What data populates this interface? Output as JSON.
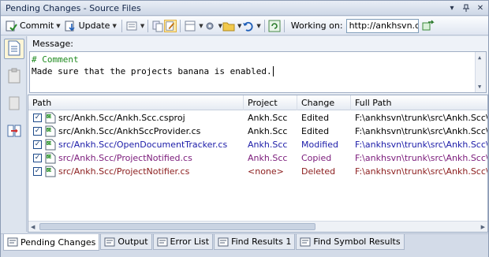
{
  "window": {
    "title": "Pending Changes - Source Files"
  },
  "toolbar": {
    "commit_label": "Commit",
    "update_label": "Update",
    "working_on_label": "Working on:",
    "working_on_value": "http://ankhsvn.c"
  },
  "message": {
    "label": "Message:",
    "lines": [
      "# Comment",
      "Made sure that the projects banana is enabled."
    ]
  },
  "table": {
    "columns": [
      "Path",
      "Project",
      "Change",
      "Full Path"
    ],
    "rows": [
      {
        "path": "src/Ankh.Scc/Ankh.Scc.csproj",
        "project": "Ankh.Scc",
        "change": "Edited",
        "full_path": "F:\\ankhsvn\\trunk\\src\\Ankh.Scc\\A",
        "checked": true,
        "color": "#000000"
      },
      {
        "path": "src/Ankh.Scc/AnkhSccProvider.cs",
        "project": "Ankh.Scc",
        "change": "Edited",
        "full_path": "F:\\ankhsvn\\trunk\\src\\Ankh.Scc\\A",
        "checked": true,
        "color": "#000000"
      },
      {
        "path": "src/Ankh.Scc/OpenDocumentTracker.cs",
        "project": "Ankh.Scc",
        "change": "Modified",
        "full_path": "F:\\ankhsvn\\trunk\\src\\Ankh.Scc\\O",
        "checked": true,
        "color": "#1b1ba8"
      },
      {
        "path": "src/Ankh.Scc/ProjectNotified.cs",
        "project": "Ankh.Scc",
        "change": "Copied",
        "full_path": "F:\\ankhsvn\\trunk\\src\\Ankh.Scc\\P",
        "checked": true,
        "color": "#7a1a7a"
      },
      {
        "path": "src/Ankh.Scc/ProjectNotifier.cs",
        "project": "<none>",
        "change": "Deleted",
        "full_path": "F:\\ankhsvn\\trunk\\src\\Ankh.Scc\\P",
        "checked": true,
        "color": "#8b1c1c"
      }
    ]
  },
  "tabs": [
    {
      "label": "Pending Changes",
      "active": true,
      "icon": "pending-changes-icon"
    },
    {
      "label": "Output",
      "active": false,
      "icon": "output-icon"
    },
    {
      "label": "Error List",
      "active": false,
      "icon": "error-list-icon"
    },
    {
      "label": "Find Results 1",
      "active": false,
      "icon": "find-results-icon"
    },
    {
      "label": "Find Symbol Results",
      "active": false,
      "icon": "find-symbol-icon"
    }
  ],
  "colors": {
    "accent": "#dde4ee",
    "comment": "#1e8a1e",
    "modified": "#1b1ba8",
    "copied": "#7a1a7a",
    "deleted": "#8b1c1c"
  }
}
